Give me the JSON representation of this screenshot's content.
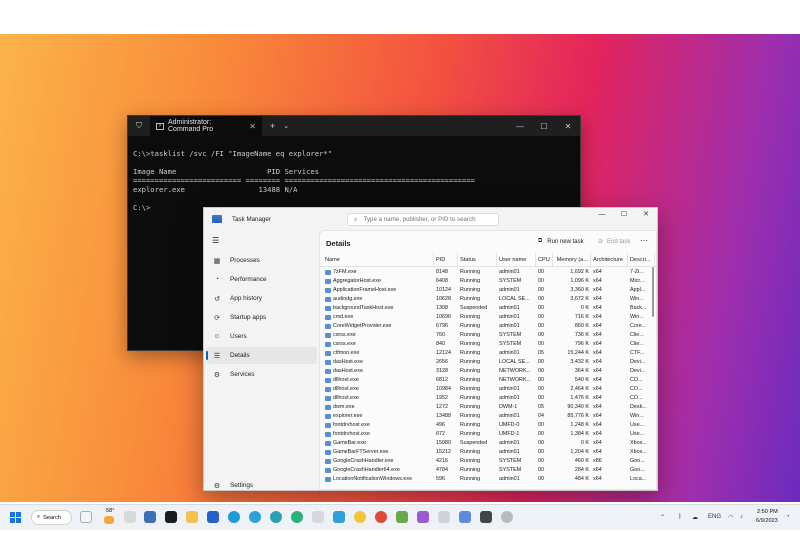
{
  "terminal": {
    "tab_title": "Administrator: Command Pro",
    "lines": [
      "C:\\>tasklist /svc /FI \"ImageName eq explorer*\"",
      "",
      "Image Name                     PID Services",
      "========================= ======== ============================================",
      "explorer.exe                 13488 N/A",
      "",
      "C:\\>"
    ]
  },
  "taskmgr": {
    "title": "Task Manager",
    "search_placeholder": "Type a name, publisher, or PID to search",
    "nav": [
      {
        "label": "Processes",
        "icon": "processes-icon",
        "glyph": "▦"
      },
      {
        "label": "Performance",
        "icon": "performance-icon",
        "glyph": "◔"
      },
      {
        "label": "App history",
        "icon": "app-history-icon",
        "glyph": "↺"
      },
      {
        "label": "Startup apps",
        "icon": "startup-icon",
        "glyph": "⟳"
      },
      {
        "label": "Users",
        "icon": "users-icon",
        "glyph": "☺"
      },
      {
        "label": "Details",
        "icon": "details-icon",
        "glyph": "☰"
      },
      {
        "label": "Services",
        "icon": "services-icon",
        "glyph": "⚙"
      }
    ],
    "settings_label": "Settings",
    "heading": "Details",
    "run_new_task": "Run new task",
    "end_task": "End task",
    "columns": [
      "Name",
      "PID",
      "Status",
      "User name",
      "CPU",
      "Memory (a...",
      "Architecture",
      "Descri..."
    ],
    "rows": [
      [
        "7zFM.exe",
        "8148",
        "Running",
        "admin01",
        "00",
        "1,692 K",
        "x64",
        "7-Zi..."
      ],
      [
        "AggregatorHost.exe",
        "6408",
        "Running",
        "SYSTEM",
        "00",
        "1,096 K",
        "x64",
        "Micr..."
      ],
      [
        "ApplicationFrameHost.exe",
        "10124",
        "Running",
        "admin01",
        "00",
        "3,360 K",
        "x64",
        "Appl..."
      ],
      [
        "audiodg.exe",
        "10628",
        "Running",
        "LOCAL SE...",
        "00",
        "3,672 K",
        "x64",
        "Win..."
      ],
      [
        "backgroundTaskHost.exe",
        "1308",
        "Suspended",
        "admin01",
        "00",
        "0 K",
        "x64",
        "Back..."
      ],
      [
        "cmd.exe",
        "10696",
        "Running",
        "admin01",
        "00",
        "716 K",
        "x64",
        "Win..."
      ],
      [
        "CoreWidgetProvider.exe",
        "6796",
        "Running",
        "admin01",
        "00",
        "860 K",
        "x64",
        "Core..."
      ],
      [
        "csrss.exe",
        "760",
        "Running",
        "SYSTEM",
        "00",
        "736 K",
        "x64",
        "Clie..."
      ],
      [
        "csrss.exe",
        "840",
        "Running",
        "SYSTEM",
        "00",
        "796 K",
        "x64",
        "Clie..."
      ],
      [
        "ctfmon.exe",
        "12124",
        "Running",
        "admin01",
        "05",
        "15,244 K",
        "x64",
        "CTF..."
      ],
      [
        "dasHost.exe",
        "2656",
        "Running",
        "LOCAL SE...",
        "00",
        "3,432 K",
        "x64",
        "Devi..."
      ],
      [
        "dasHost.exe",
        "3128",
        "Running",
        "NETWORK...",
        "00",
        "364 K",
        "x64",
        "Devi..."
      ],
      [
        "dllhost.exe",
        "6812",
        "Running",
        "NETWORK...",
        "00",
        "540 K",
        "x64",
        "CO..."
      ],
      [
        "dllhost.exe",
        "10984",
        "Running",
        "admin01",
        "00",
        "2,464 K",
        "x64",
        "CO..."
      ],
      [
        "dllhost.exe",
        "1952",
        "Running",
        "admin01",
        "00",
        "1,476 K",
        "x64",
        "CO..."
      ],
      [
        "dwm.exe",
        "1272",
        "Running",
        "DWM-1",
        "05",
        "90,340 K",
        "x64",
        "Desk..."
      ],
      [
        "explorer.exe",
        "13488",
        "Running",
        "admin01",
        "04",
        "85,776 K",
        "x64",
        "Win..."
      ],
      [
        "fontdrvhost.exe",
        "496",
        "Running",
        "UMFD-0",
        "00",
        "1,248 K",
        "x64",
        "Use..."
      ],
      [
        "fontdrvhost.exe",
        "672",
        "Running",
        "UMFD-1",
        "00",
        "1,384 K",
        "x64",
        "Use..."
      ],
      [
        "GameBar.exe",
        "15080",
        "Suspended",
        "admin01",
        "00",
        "0 K",
        "x64",
        "Xbox..."
      ],
      [
        "GameBarFTServer.exe",
        "15212",
        "Running",
        "admin01",
        "00",
        "1,204 K",
        "x64",
        "Xbox..."
      ],
      [
        "GoogleCrashHandler.exe",
        "4216",
        "Running",
        "SYSTEM",
        "00",
        "460 K",
        "x86",
        "Goo..."
      ],
      [
        "GoogleCrashHandler64.exe",
        "4784",
        "Running",
        "SYSTEM",
        "00",
        "284 K",
        "x64",
        "Goo..."
      ],
      [
        "LocationNotificationWindows.exe",
        "596",
        "Running",
        "admin01",
        "00",
        "484 K",
        "x64",
        "Loca..."
      ]
    ]
  },
  "taskbar": {
    "search_label": "Search",
    "weather": "58°",
    "lang": "ENG",
    "time": "2:50 PM",
    "date": "6/9/2023"
  }
}
